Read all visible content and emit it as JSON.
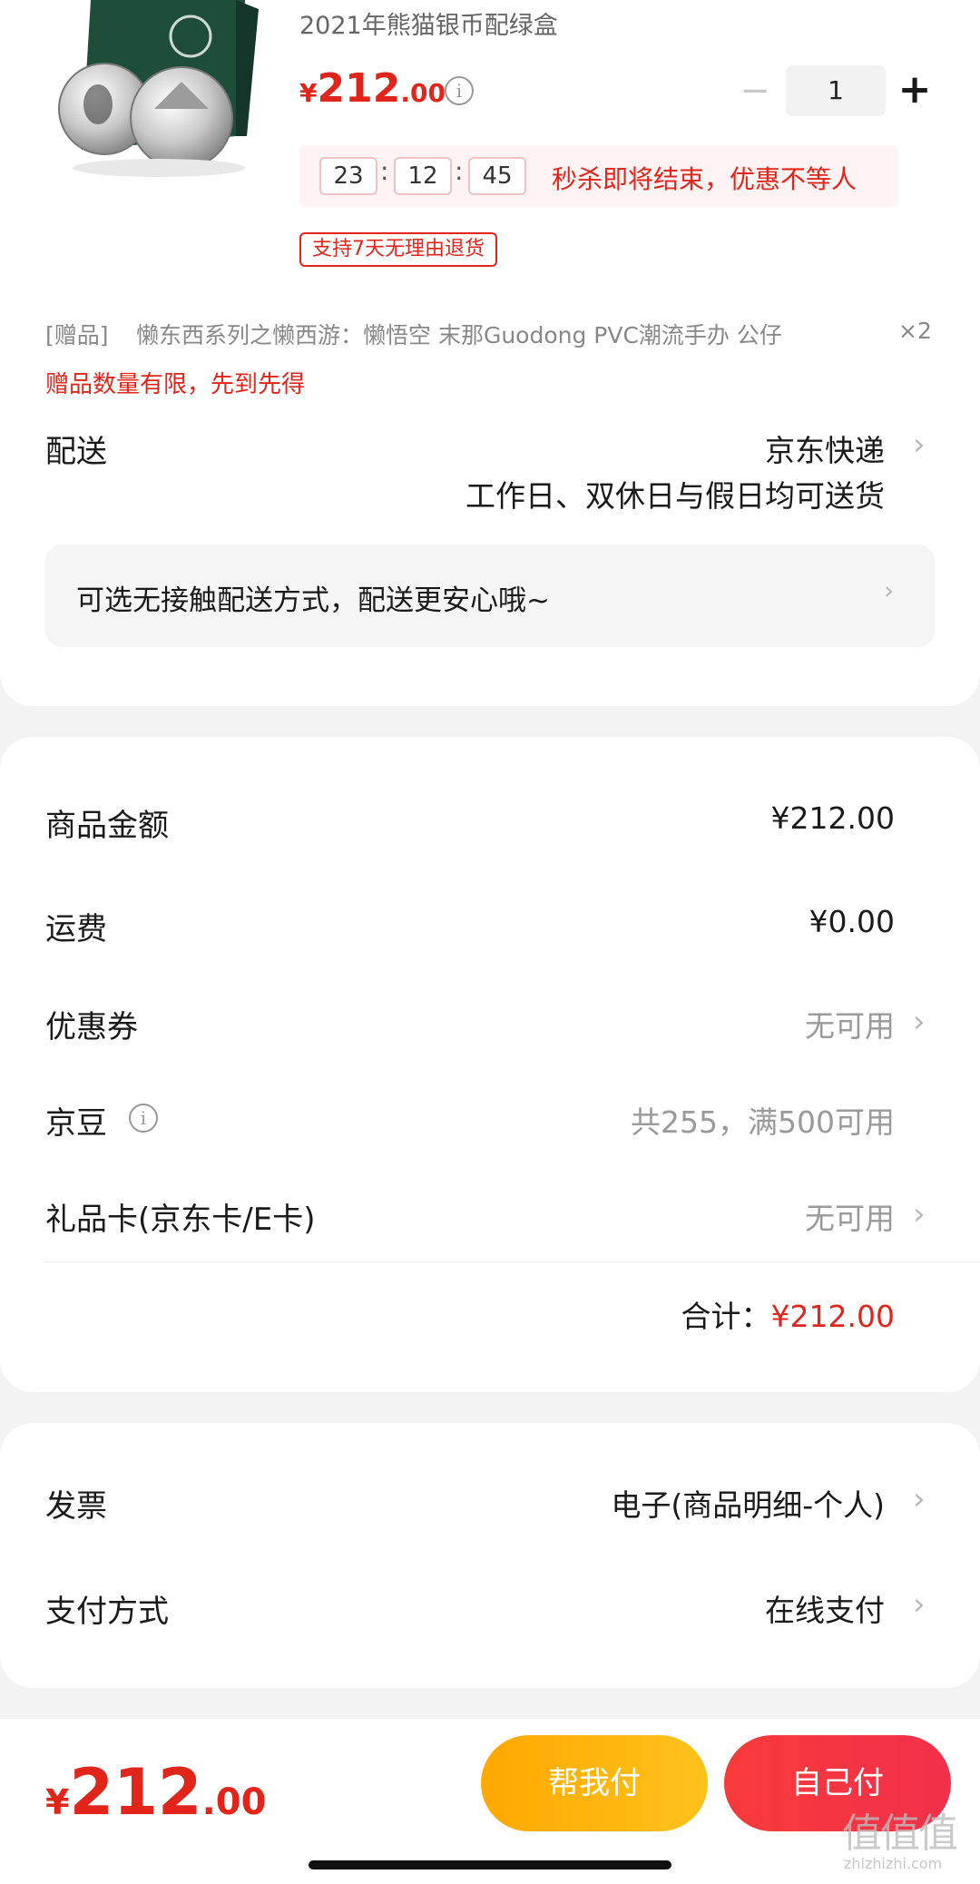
{
  "product": {
    "title": "2021年熊猫银币配绿盒",
    "price_symbol": "¥",
    "price_int": "212",
    "price_dec": ".00",
    "qty_minus": "−",
    "qty_value": "1",
    "qty_plus": "+"
  },
  "flash_sale": {
    "hours": "23",
    "minutes": "12",
    "seconds": "45",
    "sep": ":",
    "text": "秒杀即将结束，优惠不等人"
  },
  "return_badge": "支持7天无理由退货",
  "gift": {
    "tag": "[赠品]",
    "name": "懒东西系列之懒西游：懒悟空 末那Guodong PVC潮流手办 公仔",
    "count": "×2",
    "notice": "赠品数量有限，先到先得"
  },
  "delivery": {
    "label": "配送",
    "carrier": "京东快递",
    "schedule": "工作日、双休日与假日均可送货",
    "contactless": "可选无接触配送方式，配送更安心哦~"
  },
  "summary": {
    "goods_label": "商品金额",
    "goods_value": "¥212.00",
    "shipping_label": "运费",
    "shipping_value": "¥0.00",
    "coupon_label": "优惠券",
    "coupon_value": "无可用",
    "jingdou_label": "京豆",
    "jingdou_value": "共255，满500可用",
    "giftcard_label": "礼品卡(京东卡/E卡)",
    "giftcard_value": "无可用",
    "total_label": "合计：",
    "total_value": "¥212.00"
  },
  "invoice": {
    "label": "发票",
    "value": "电子(商品明细-个人)"
  },
  "payment": {
    "label": "支付方式",
    "value": "在线支付"
  },
  "bottom": {
    "price_symbol": "¥",
    "price_int": "212",
    "price_dec": ".00",
    "help_pay": "帮我付",
    "self_pay": "自己付"
  },
  "watermark": "值值值",
  "watermark_sub": "zhizhizhi.com",
  "colors": {
    "accent_red": "#e1251b",
    "help_pay_bg": "#ffb400",
    "self_pay_bg": "#f23030"
  },
  "icons": [
    "info-icon",
    "chevron-right-icon",
    "minus-icon",
    "plus-icon"
  ]
}
